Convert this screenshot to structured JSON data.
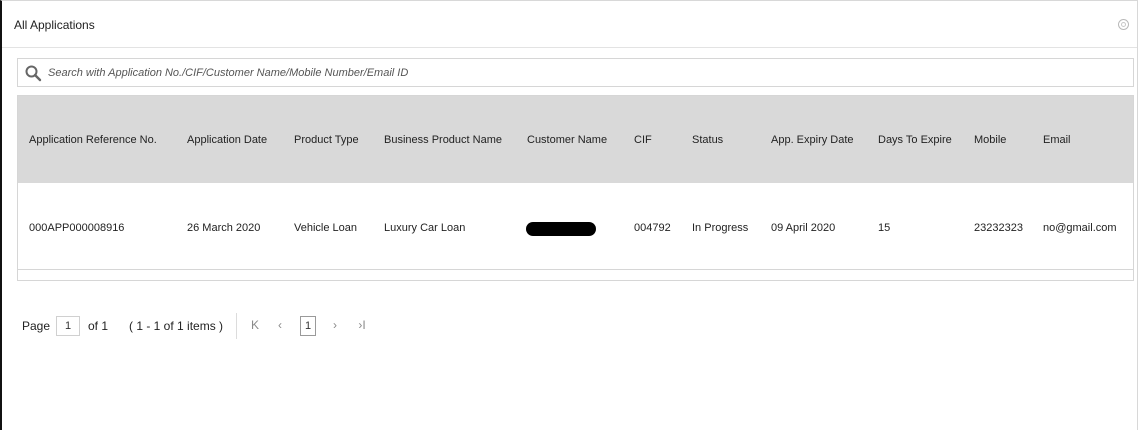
{
  "panel": {
    "title": "All Applications"
  },
  "search": {
    "placeholder": "Search with Application No./CIF/Customer Name/Mobile Number/Email ID",
    "value": ""
  },
  "grid": {
    "columns": [
      "Application Reference No.",
      "Application Date",
      "Product Type",
      "Business Product Name",
      "Customer Name",
      "CIF",
      "Status",
      "App. Expiry Date",
      "Days To Expire",
      "Mobile",
      "Email"
    ],
    "rows": [
      {
        "ref": "000APP000008916",
        "date": "26 March 2020",
        "product_type": "Vehicle Loan",
        "business_product": "Luxury Car Loan",
        "customer_name": "",
        "cif": "004792",
        "status": "In Progress",
        "expiry": "09 April 2020",
        "days": "15",
        "mobile": "23232323",
        "email": "no@gmail.com"
      }
    ]
  },
  "pager": {
    "page_label": "Page",
    "page_value": "1",
    "of_label": "of 1",
    "items_label": "( 1 - 1 of 1 items )",
    "current_page": "1",
    "first_icon": "K",
    "prev_icon": "‹",
    "next_icon": "›",
    "last_icon": "›I"
  },
  "colors": {
    "header_bg": "#d9d9d9",
    "border": "#d6d6d6"
  }
}
